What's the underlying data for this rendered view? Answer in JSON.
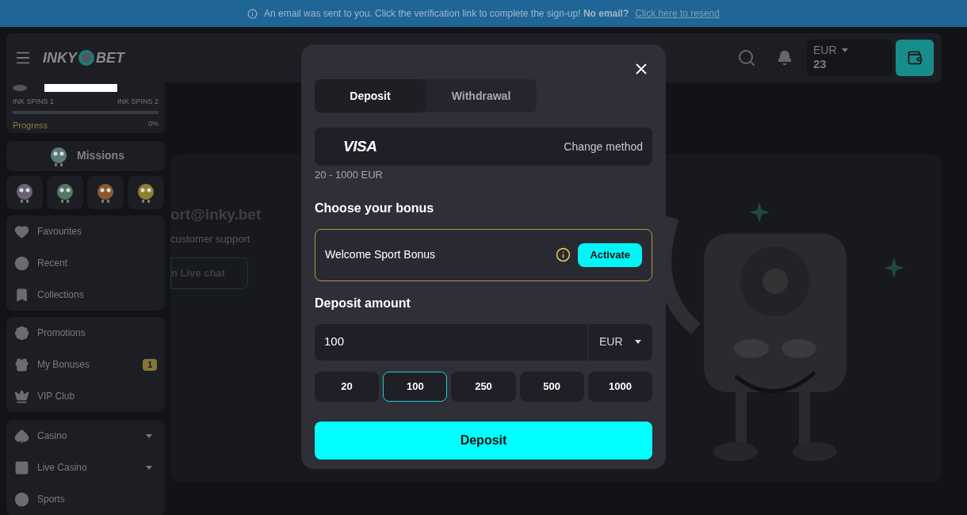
{
  "banner": {
    "text": "An email was sent to you. Click the verification link to complete the sign-up! **No email?**",
    "link": "Click here to resend"
  },
  "header": {
    "logo_left": "INKY",
    "logo_right": "BET",
    "balance_currency": "EUR",
    "balance_amount": "23"
  },
  "sidebar": {
    "progress_card": {
      "left_label": "INK SPINS 1",
      "right_label": "INK SPINS 2",
      "level": 0,
      "progress_label": "Progress",
      "progress_value": "0%"
    },
    "missions": "Missions",
    "groups": [
      [
        {
          "label": "Favourites"
        },
        {
          "label": "Recent"
        },
        {
          "label": "Collections"
        }
      ],
      [
        {
          "label": "Promotions"
        },
        {
          "label": "My Bonuses",
          "badge": "1"
        },
        {
          "label": "VIP Club"
        }
      ],
      [
        {
          "label": "Casino",
          "expandable": true
        },
        {
          "label": "Live Casino",
          "expandable": true
        },
        {
          "label": "Sports",
          "expandable": false
        }
      ]
    ]
  },
  "background": {
    "email": "ort@inky.bet",
    "subtitle": "customer support",
    "button": "n Live chat"
  },
  "modal": {
    "tabs": [
      {
        "label": "Deposit",
        "selected": true
      },
      {
        "label": "Withdrawal",
        "selected": false
      }
    ],
    "method": {
      "brand": "VISA",
      "action": "Change method"
    },
    "limits": "20 - 1000 EUR",
    "bonus_heading": "Choose your bonus",
    "bonus": {
      "name": "Welcome Sport Bonus",
      "button": "Activate"
    },
    "amount_heading": "Deposit amount",
    "amount": {
      "value": "100",
      "currency": "EUR"
    },
    "presets": [
      {
        "label": "20",
        "selected": false
      },
      {
        "label": "100",
        "selected": true
      },
      {
        "label": "250",
        "selected": false
      },
      {
        "label": "500",
        "selected": false
      },
      {
        "label": "1000",
        "selected": false
      }
    ],
    "submit": "Deposit"
  }
}
